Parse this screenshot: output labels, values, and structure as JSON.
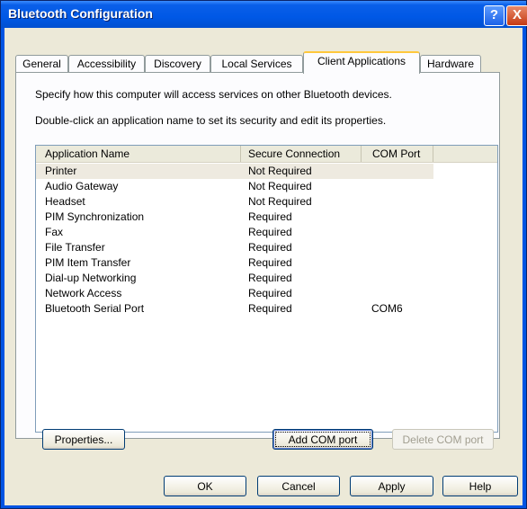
{
  "window": {
    "title": "Bluetooth Configuration"
  },
  "titlebar": {
    "help_glyph": "?",
    "close_glyph": "X"
  },
  "tabs": [
    {
      "label": "General"
    },
    {
      "label": "Accessibility"
    },
    {
      "label": "Discovery"
    },
    {
      "label": "Local Services"
    },
    {
      "label": "Client Applications"
    },
    {
      "label": "Hardware"
    }
  ],
  "active_tab": "Client Applications",
  "panel": {
    "description1": "Specify how this computer will access services on other Bluetooth devices.",
    "description2": "Double-click an application name to set its security and edit its properties."
  },
  "list": {
    "columns": [
      "Application Name",
      "Secure Connection",
      "COM Port"
    ],
    "rows": [
      [
        "Printer",
        "Not Required",
        ""
      ],
      [
        "Audio Gateway",
        "Not Required",
        ""
      ],
      [
        "Headset",
        "Not Required",
        ""
      ],
      [
        "PIM Synchronization",
        "Required",
        ""
      ],
      [
        "Fax",
        "Required",
        ""
      ],
      [
        "File Transfer",
        "Required",
        ""
      ],
      [
        "PIM Item Transfer",
        "Required",
        ""
      ],
      [
        "Dial-up Networking",
        "Required",
        ""
      ],
      [
        "Network Access",
        "Required",
        ""
      ],
      [
        "Bluetooth Serial Port",
        "Required",
        "COM6"
      ]
    ]
  },
  "buttons": {
    "properties": "Properties...",
    "add_com_port": "Add COM port",
    "delete_com_port": "Delete COM port",
    "ok": "OK",
    "cancel": "Cancel",
    "apply": "Apply",
    "help": "Help"
  }
}
